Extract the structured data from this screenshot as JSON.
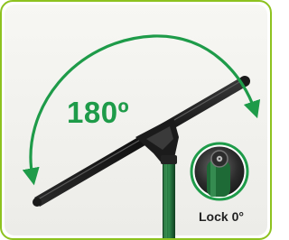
{
  "figure": {
    "rotation_label": "180º",
    "lock_label": "Lock 0°",
    "colors": {
      "border": "#8dc21f",
      "arrow": "#1e9b49",
      "bar": "#1f1f1f",
      "stand": "#1e6a36"
    },
    "icons": {
      "rotation_arrow": "curved-double-arrow-icon",
      "lock_detail": "lock-knob-closeup-icon"
    }
  }
}
